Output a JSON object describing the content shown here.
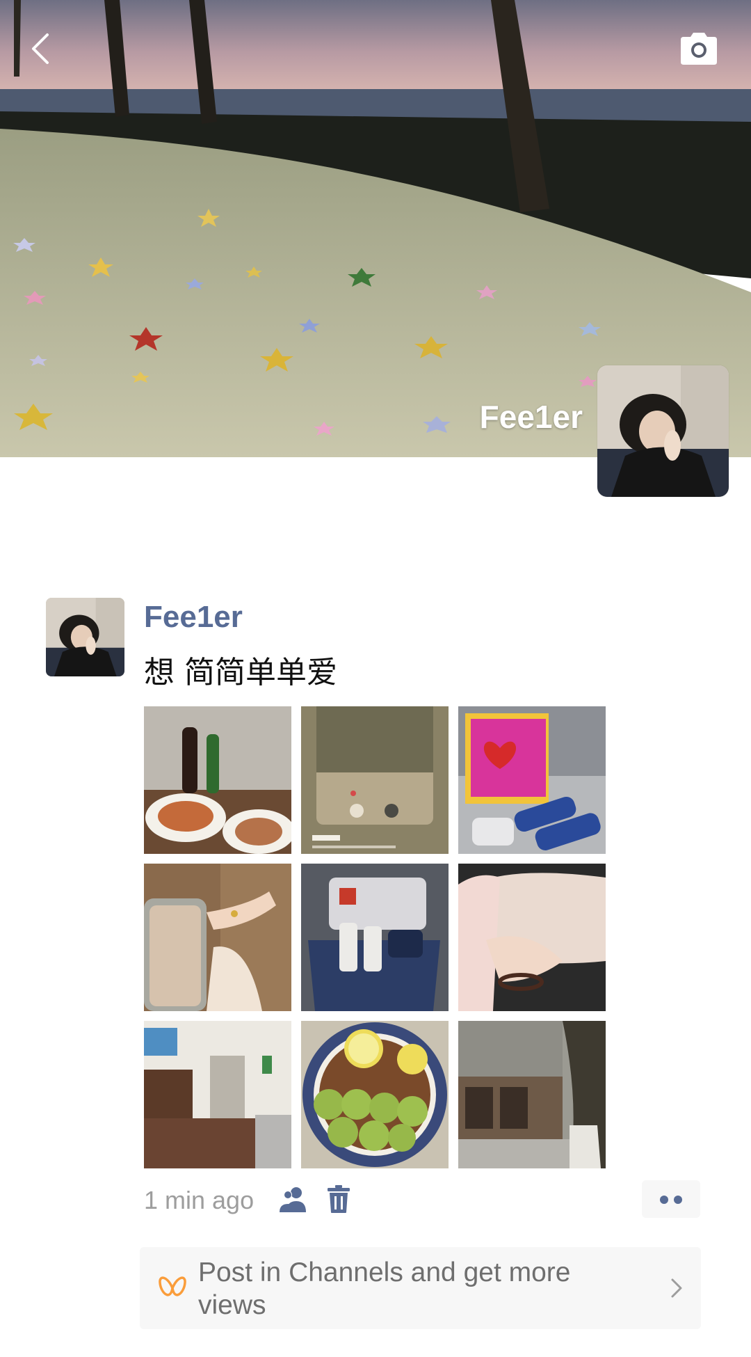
{
  "app": "WeChat Moments",
  "cover": {
    "username": "Fee1er",
    "back_icon": "chevron-left-icon",
    "camera_icon": "camera-icon"
  },
  "post": {
    "author": "Fee1er",
    "text": "想 简简单单爱",
    "photo_count": 9,
    "photos": [
      {
        "description": "food-and-cola"
      },
      {
        "description": "music-player-screenshot"
      },
      {
        "description": "kiehls-products"
      },
      {
        "description": "hand-with-bracelet"
      },
      {
        "description": "kiehls-bag"
      },
      {
        "description": "hand-on-lap"
      },
      {
        "description": "cafe-interior"
      },
      {
        "description": "lemon-dessert-bowl"
      },
      {
        "description": "building-and-tree"
      }
    ],
    "time_ago": "1 min ago",
    "visibility_icon": "people-icon",
    "delete_icon": "trash-icon",
    "more_icon": "two-dots-icon"
  },
  "channels_banner": {
    "text": "Post in Channels and get more views",
    "icon": "channels-butterfly-icon",
    "chevron_icon": "chevron-right-icon"
  },
  "colors": {
    "link_blue": "#576b95",
    "channels_orange": "#fa9d3b",
    "meta_gray": "#9d9d9d"
  }
}
